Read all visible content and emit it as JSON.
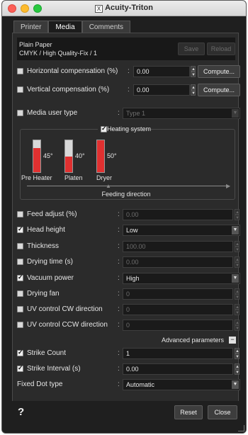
{
  "window": {
    "title": "Acuity-Triton",
    "app_icon_glyph": "X"
  },
  "tabs": [
    {
      "label": "Printer",
      "active": false
    },
    {
      "label": "Media",
      "active": true
    },
    {
      "label": "Comments",
      "active": false
    }
  ],
  "media": {
    "name": "Plain Paper",
    "description": "CMYK / High Quality-Fix / 1",
    "save_label": "Save",
    "reload_label": "Reload"
  },
  "compensation": {
    "horizontal": {
      "label": "Horizontal compensation (%)",
      "checked": false,
      "value": "0.00",
      "button": "Compute..."
    },
    "vertical": {
      "label": "Vertical compensation (%)",
      "checked": false,
      "value": "0.00",
      "button": "Compute..."
    }
  },
  "media_user_type": {
    "label": "Media user type",
    "checked": false,
    "value": "Type 1"
  },
  "heating": {
    "label": "Heating system",
    "checked": true,
    "heaters": [
      {
        "name": "Pre Heater",
        "value": "45°",
        "level": 0.75
      },
      {
        "name": "Platen",
        "value": "40°",
        "level": 0.5
      },
      {
        "name": "Dryer",
        "value": "50°",
        "level": 1.0
      }
    ],
    "feed_label": "Feeding direction"
  },
  "params": {
    "feed_adjust": {
      "label": "Feed adjust (%)",
      "checked": false,
      "value": "0.00"
    },
    "head_height": {
      "label": "Head height",
      "checked": true,
      "value": "Low"
    },
    "thickness": {
      "label": "Thickness",
      "checked": false,
      "value": "100.00"
    },
    "drying_time": {
      "label": "Drying time (s)",
      "checked": false,
      "value": "0.00"
    },
    "vacuum_power": {
      "label": "Vacuum power",
      "checked": true,
      "value": "High"
    },
    "drying_fan": {
      "label": "Drying fan",
      "checked": false,
      "value": "0"
    },
    "uv_cw": {
      "label": "UV control CW direction",
      "checked": false,
      "value": "0"
    },
    "uv_ccw": {
      "label": "UV control CCW direction",
      "checked": false,
      "value": "0"
    }
  },
  "advanced": {
    "label": "Advanced parameters",
    "toggle": "−"
  },
  "strike": {
    "count": {
      "label": "Strike Count",
      "checked": true,
      "value": "1"
    },
    "interval": {
      "label": "Strike Interval (s)",
      "checked": true,
      "value": "0.00"
    }
  },
  "fixed_dot": {
    "label": "Fixed Dot type",
    "value": "Automatic"
  },
  "footer": {
    "help": "?",
    "reset_label": "Reset",
    "close_label": "Close"
  },
  "colors": {
    "accent_red": "#e03030",
    "panel_bg": "#2b2b2b"
  }
}
